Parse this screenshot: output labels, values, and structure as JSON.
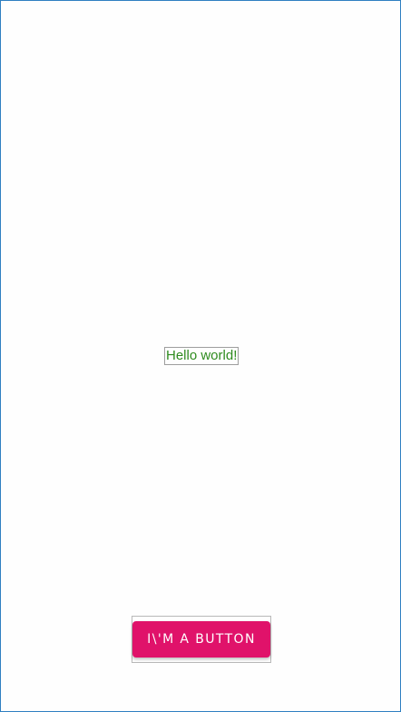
{
  "content": {
    "hello_text": "Hello world!",
    "button_label": "I\\'M A BUTTON"
  },
  "colors": {
    "text_green": "#2e8b1e",
    "button_bg": "#e0126a",
    "button_text": "#ffffff",
    "frame_border": "#2f7fc1"
  }
}
